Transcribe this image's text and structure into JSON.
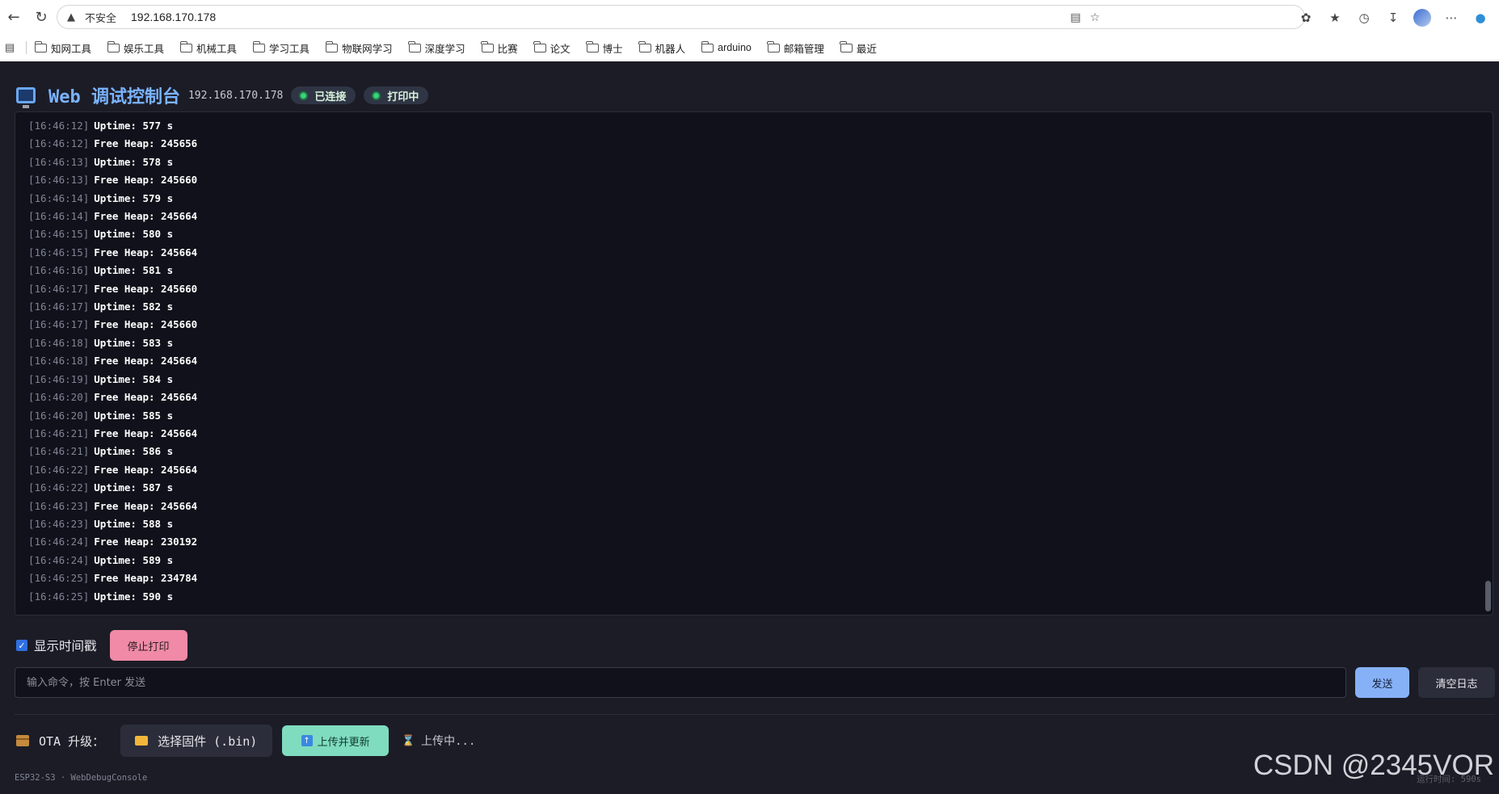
{
  "browser": {
    "security_label": "不安全",
    "url": "192.168.170.178",
    "bookmarks": [
      "知网工具",
      "娱乐工具",
      "机械工具",
      "学习工具",
      "物联网学习",
      "深度学习",
      "比赛",
      "论文",
      "博士",
      "机器人",
      "arduino",
      "邮箱管理",
      "最近"
    ]
  },
  "header": {
    "title": "Web 调试控制台",
    "ip": "192.168.170.178",
    "badge_connected": "已连接",
    "badge_printing": "打印中",
    "status_color": "#3ad27a"
  },
  "log": [
    {
      "ts": "[16:46:12]",
      "msg": "Uptime: 577 s"
    },
    {
      "ts": "[16:46:12]",
      "msg": "Free Heap: 245656"
    },
    {
      "ts": "[16:46:13]",
      "msg": "Uptime: 578 s"
    },
    {
      "ts": "[16:46:13]",
      "msg": "Free Heap: 245660"
    },
    {
      "ts": "[16:46:14]",
      "msg": "Uptime: 579 s"
    },
    {
      "ts": "[16:46:14]",
      "msg": "Free Heap: 245664"
    },
    {
      "ts": "[16:46:15]",
      "msg": "Uptime: 580 s"
    },
    {
      "ts": "[16:46:15]",
      "msg": "Free Heap: 245664"
    },
    {
      "ts": "[16:46:16]",
      "msg": "Uptime: 581 s"
    },
    {
      "ts": "[16:46:17]",
      "msg": "Free Heap: 245660"
    },
    {
      "ts": "[16:46:17]",
      "msg": "Uptime: 582 s"
    },
    {
      "ts": "[16:46:17]",
      "msg": "Free Heap: 245660"
    },
    {
      "ts": "[16:46:18]",
      "msg": "Uptime: 583 s"
    },
    {
      "ts": "[16:46:18]",
      "msg": "Free Heap: 245664"
    },
    {
      "ts": "[16:46:19]",
      "msg": "Uptime: 584 s"
    },
    {
      "ts": "[16:46:20]",
      "msg": "Free Heap: 245664"
    },
    {
      "ts": "[16:46:20]",
      "msg": "Uptime: 585 s"
    },
    {
      "ts": "[16:46:21]",
      "msg": "Free Heap: 245664"
    },
    {
      "ts": "[16:46:21]",
      "msg": "Uptime: 586 s"
    },
    {
      "ts": "[16:46:22]",
      "msg": "Free Heap: 245664"
    },
    {
      "ts": "[16:46:22]",
      "msg": "Uptime: 587 s"
    },
    {
      "ts": "[16:46:23]",
      "msg": "Free Heap: 245664"
    },
    {
      "ts": "[16:46:23]",
      "msg": "Uptime: 588 s"
    },
    {
      "ts": "[16:46:24]",
      "msg": "Free Heap: 230192"
    },
    {
      "ts": "[16:46:24]",
      "msg": "Uptime: 589 s"
    },
    {
      "ts": "[16:46:25]",
      "msg": "Free Heap: 234784"
    },
    {
      "ts": "[16:46:25]",
      "msg": "Uptime: 590 s"
    }
  ],
  "controls": {
    "show_timestamp_label": "显示时间戳",
    "show_timestamp_checked": true,
    "stop_print_label": "停止打印",
    "command_placeholder": "输入命令，按 Enter 发送",
    "command_value": "",
    "send_label": "发送",
    "clear_label": "清空日志"
  },
  "ota": {
    "label": "OTA 升级：",
    "choose_label": "选择固件 (.bin)",
    "upload_label": "上传并更新",
    "status": "上传中..."
  },
  "footer": {
    "text": "ESP32-S3 · WebDebugConsole",
    "runtime": "运行时间: 590s"
  },
  "watermark": "CSDN @2345VOR"
}
